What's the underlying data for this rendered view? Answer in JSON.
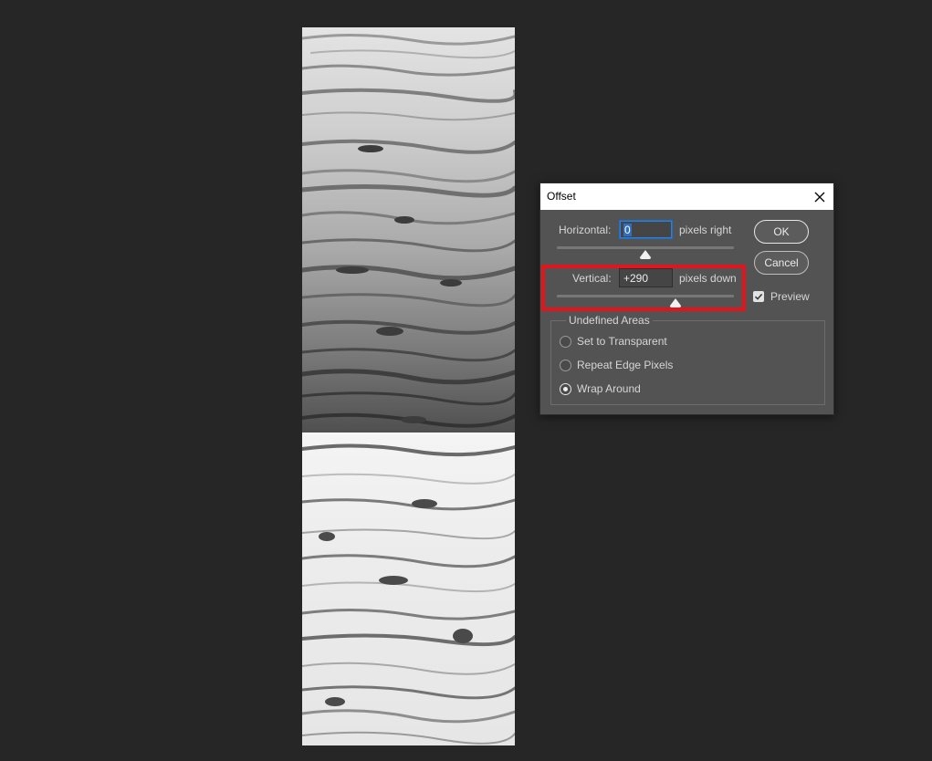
{
  "dialog": {
    "title": "Offset",
    "horizontal": {
      "label": "Horizontal:",
      "value": "0",
      "unit": "pixels right",
      "slider_level": 0.5
    },
    "vertical": {
      "label": "Vertical:",
      "value": "+290",
      "unit": "pixels down",
      "slider_level": 0.67
    },
    "ok_label": "OK",
    "cancel_label": "Cancel",
    "preview_label": "Preview",
    "preview_checked": true,
    "undefined_areas": {
      "title": "Undefined Areas",
      "options": [
        "Set to Transparent",
        "Repeat Edge Pixels",
        "Wrap Around"
      ],
      "selected": "Wrap Around"
    }
  },
  "icons": {
    "close": "close-icon",
    "check": "checkmark-icon"
  },
  "colors": {
    "highlight": "#e3141b",
    "background": "#262626",
    "dialog": "#535353"
  }
}
